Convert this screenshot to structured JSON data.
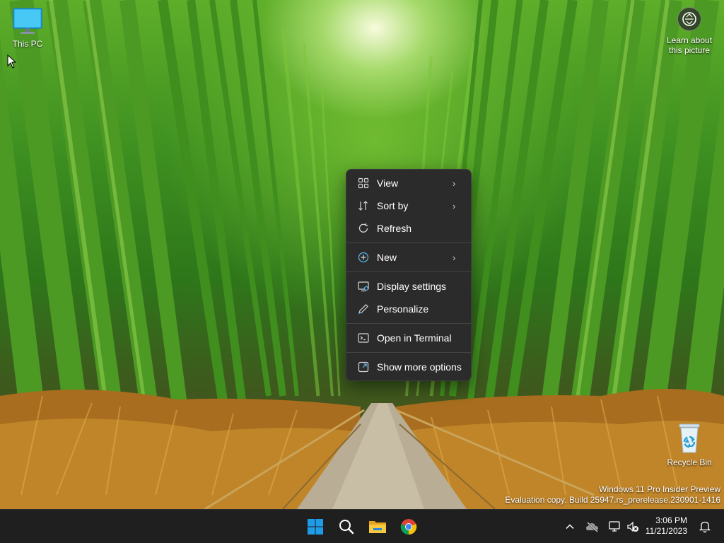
{
  "desktop": {
    "icons": [
      {
        "label": "This PC"
      },
      {
        "label": "Recycle Bin"
      }
    ],
    "learn_about": {
      "line1": "Learn about",
      "line2": "this picture"
    }
  },
  "context_menu": {
    "items": [
      {
        "label": "View",
        "icon": "grid-icon",
        "submenu": true
      },
      {
        "label": "Sort by",
        "icon": "sort-icon",
        "submenu": true
      },
      {
        "label": "Refresh",
        "icon": "refresh-icon",
        "submenu": false
      },
      {
        "label": "New",
        "icon": "plus-circle-icon",
        "submenu": true
      },
      {
        "label": "Display settings",
        "icon": "display-settings-icon",
        "submenu": false
      },
      {
        "label": "Personalize",
        "icon": "pen-icon",
        "submenu": false
      },
      {
        "label": "Open in Terminal",
        "icon": "terminal-icon",
        "submenu": false
      },
      {
        "label": "Show more options",
        "icon": "expand-icon",
        "submenu": false
      }
    ]
  },
  "watermark": {
    "line1": "Windows 11 Pro Insider Preview",
    "line2": "Evaluation copy. Build 25947.rs_prerelease.230901-1416"
  },
  "taskbar": {
    "pinned": [
      "windows-start-icon",
      "search-icon",
      "file-explorer-icon",
      "chrome-icon"
    ],
    "tray": [
      "chevron-up-icon",
      "onedrive-offline-icon",
      "network-icon",
      "volume-muted-icon"
    ],
    "time": "3:06 PM",
    "date": "11/21/2023"
  },
  "colors": {
    "menu_bg": "#2b2b2b",
    "taskbar_bg": "#1f1f1f",
    "windows_blue": "#1f9ce8",
    "folder_yellow": "#f5b82e"
  }
}
